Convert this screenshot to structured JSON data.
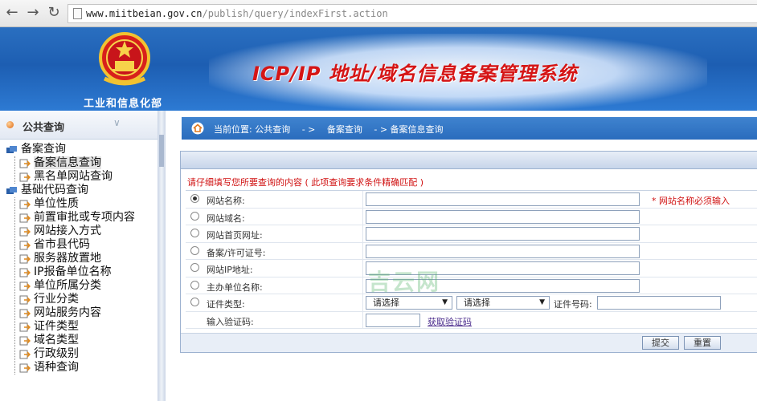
{
  "browser": {
    "url_host": "www.miitbeian.gov.cn",
    "url_path": "/publish/query/indexFirst.action"
  },
  "banner": {
    "ministry": "工业和信息化部",
    "title": "ICP/IP 地址/域名信息备案管理系统"
  },
  "sidebar": {
    "title": "公共查询",
    "groups": [
      {
        "label": "备案查询",
        "items": [
          "备案信息查询",
          "黑名单网站查询"
        ]
      },
      {
        "label": "基础代码查询",
        "items": [
          "单位性质",
          "前置审批或专项内容",
          "网站接入方式",
          "省市县代码",
          "服务器放置地",
          "IP报备单位名称",
          "单位所属分类",
          "行业分类",
          "网站服务内容",
          "证件类型",
          "域名类型",
          "行政级别",
          "语种查询"
        ]
      }
    ]
  },
  "breadcrumb": {
    "text": "当前位置: 公共查询　 - >　 备案查询　 - > 备案信息查询"
  },
  "form": {
    "notice": "请仔细填写您所要查询的内容 ( 此项查询要求条件精确匹配 )",
    "fields": [
      {
        "label": "网站名称:",
        "selected": true
      },
      {
        "label": "网站域名:",
        "selected": false
      },
      {
        "label": "网站首页网址:",
        "selected": false
      },
      {
        "label": "备案/许可证号:",
        "selected": false
      },
      {
        "label": "网站IP地址:",
        "selected": false
      },
      {
        "label": "主办单位名称:",
        "selected": false
      }
    ],
    "required_note": "* 网站名称必须输入",
    "cert_type_label": "证件类型:",
    "select1": "请选择",
    "select2": "请选择",
    "cert_number_label": "证件号码:",
    "captcha_label": "输入验证码:",
    "captcha_link": "获取验证码",
    "submit": "提交",
    "reset": "重置"
  },
  "watermark": "吉云网"
}
